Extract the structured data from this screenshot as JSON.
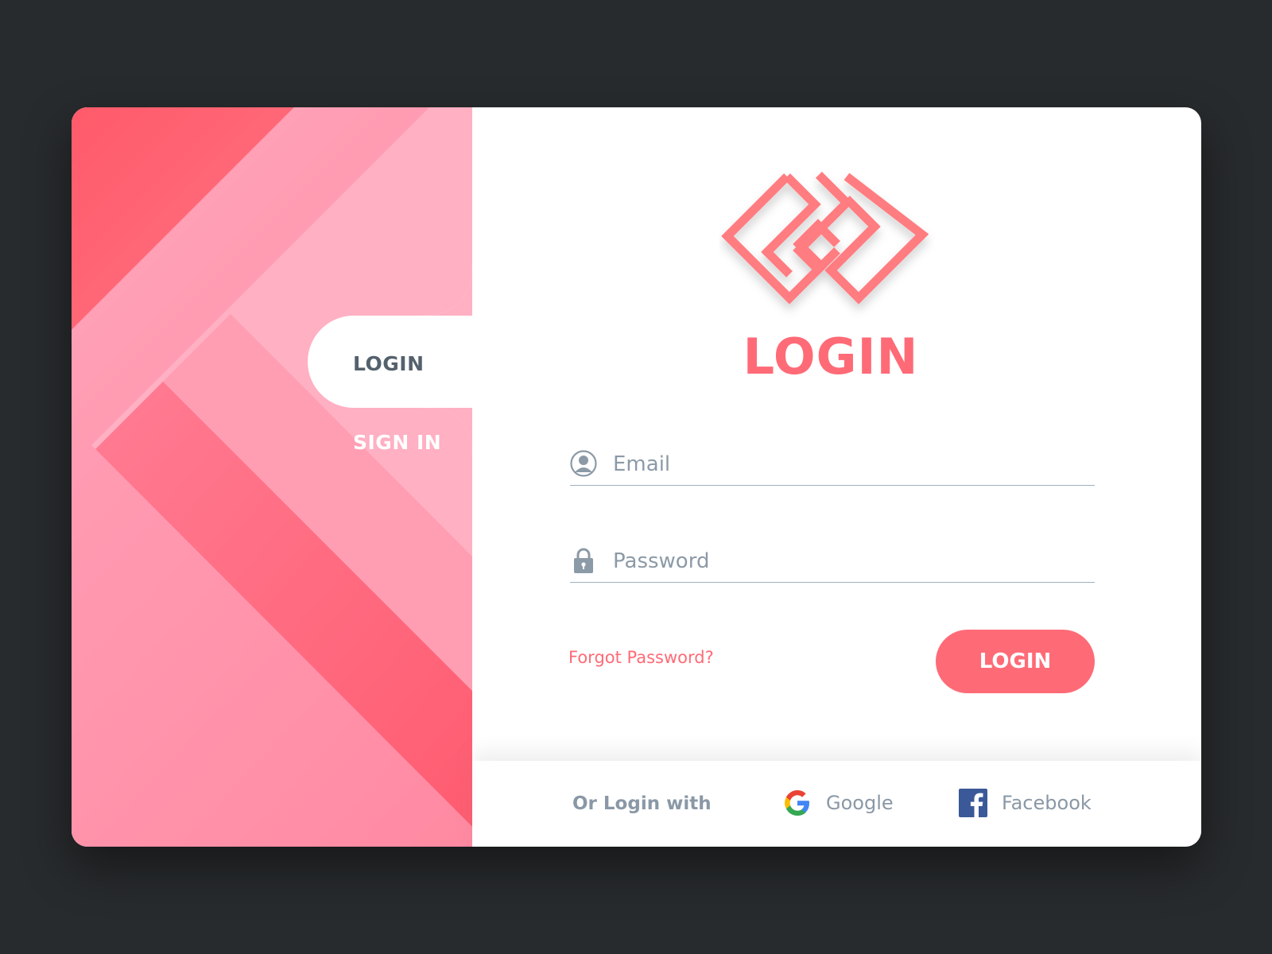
{
  "tabs": {
    "login_label": "LOGIN",
    "signin_label": "SIGN IN"
  },
  "logo": {
    "icon": "maze-diamond-logo"
  },
  "title": "LOGIN",
  "form": {
    "email_placeholder": "Email",
    "password_placeholder": "Password",
    "forgot_label": "Forgot Password?",
    "login_button": "LOGIN"
  },
  "footer": {
    "or_login_with": "Or Login with",
    "google_label": "Google",
    "facebook_label": "Facebook"
  },
  "colors": {
    "accent": "#fe6b77",
    "page_background": "#282b2d",
    "muted_text": "#8a98a6",
    "tab_text": "#54616d"
  }
}
